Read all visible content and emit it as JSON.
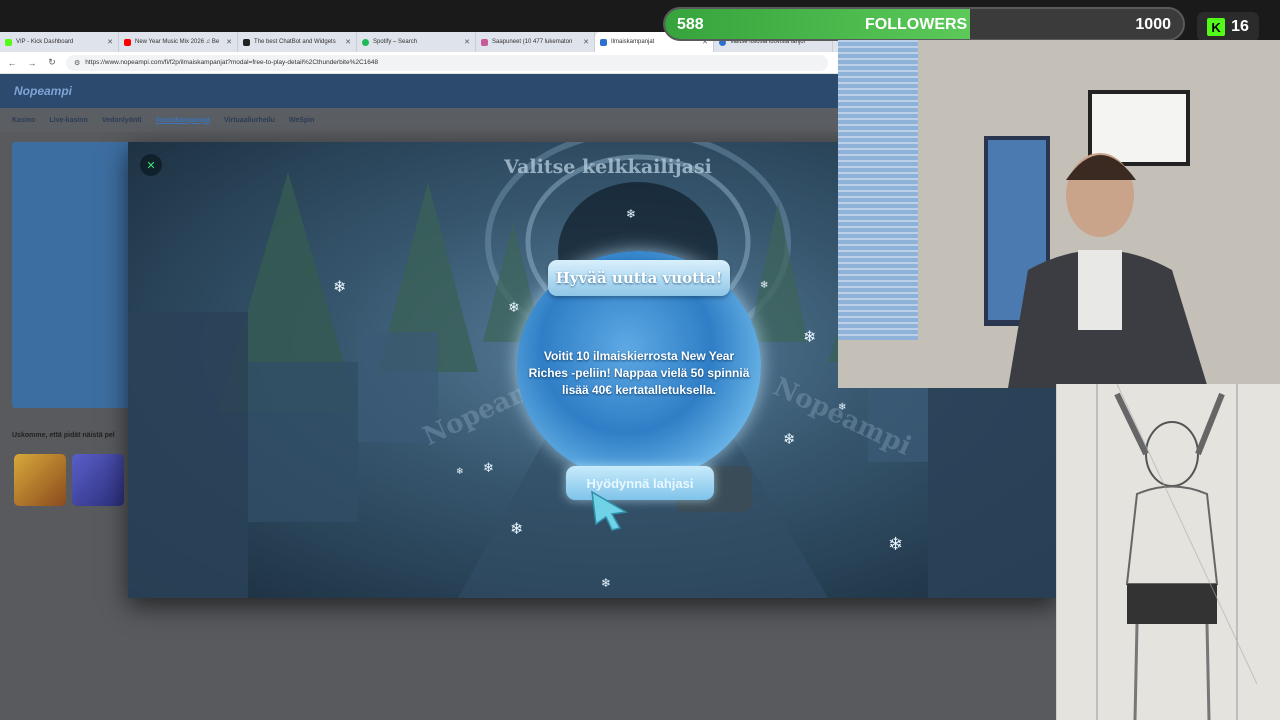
{
  "browser": {
    "tabs": [
      {
        "label": "VIP - Kick Dashboard",
        "color": "#53fc18",
        "active": false
      },
      {
        "label": "New Year Music Mix 2026 ♫ Be",
        "color": "#ff0000",
        "active": false
      },
      {
        "label": "The best ChatBot and Widgets",
        "color": "#222222",
        "active": false
      },
      {
        "label": "Spotify – Search",
        "color": "#1db954",
        "active": false
      },
      {
        "label": "Saapuneet (10 477 lukematon",
        "color": "#c85a9a",
        "active": false
      },
      {
        "label": "Ilmaiskampanjat",
        "color": "#2f6fd0",
        "active": true
      },
      {
        "label": "Valitse lisiosia luovista lahjoi",
        "color": "#2f6fd0",
        "active": false
      }
    ],
    "url": "https://www.nopeampi.com/fi/f2p/ilmaiskampanjat?modal=free-to-play-detail%2Cthunderbite%2C1648"
  },
  "site": {
    "logo": "Nopeampi",
    "nav": [
      "Kasino",
      "Live-kasino",
      "Vedonlyönti",
      "Ilmaiskampanjat",
      "Virtuaaliurheilu",
      "WeSpin"
    ],
    "active_nav": "Ilmaiskampanjat",
    "bottom_text": "Uskomme, että pidät näistä pel"
  },
  "modal": {
    "title": "Valitse kelkkailijasi",
    "banner": "Hyvää uutta vuotta!",
    "message": "Voitit 10 ilmaiskierrosta New Year Riches -peliin! Nappaa vielä 50 spinniä lisää 40€ kertatalletuksella.",
    "button": "Hyödynnä lahjasi",
    "watermark_left": "Nopeampi",
    "watermark_right": "Nopeampi",
    "close_icon": "close-icon"
  },
  "overlay": {
    "followers_current": "588",
    "followers_label": "FOLLOWERS",
    "followers_goal": "1000",
    "followers_progress": 0.588,
    "kick_count": "16",
    "kick_icon": "K"
  }
}
